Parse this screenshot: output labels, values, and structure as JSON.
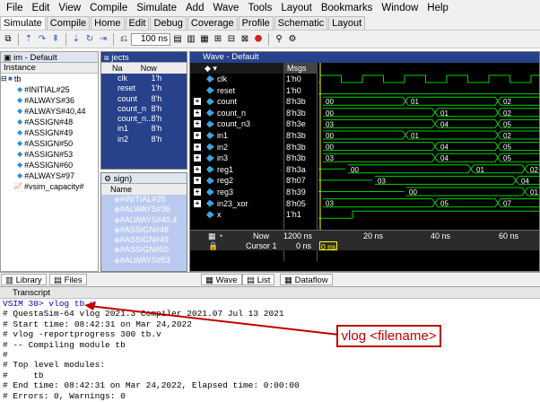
{
  "menubar": {
    "items": [
      "File",
      "Edit",
      "View",
      "Compile",
      "Simulate",
      "Add",
      "Wave",
      "Tools",
      "Layout",
      "Bookmarks",
      "Window",
      "Help"
    ]
  },
  "tabs": [
    "Simulate",
    "Compile",
    "Home",
    "Edit",
    "Debug",
    "Coverage",
    "Profile",
    "Schematic",
    "Layout"
  ],
  "toolbar": {
    "run_length": "100 ns"
  },
  "instance_panel": {
    "title": "im - Default",
    "column_header": "Instance",
    "root": "tb",
    "children": [
      "#INITIAL#25",
      "#ALWAYS#36",
      "#ALWAYS#40,44",
      "#ASSIGN#48",
      "#ASSIGN#49",
      "#ASSIGN#50",
      "#ASSIGN#53",
      "#ASSIGN#60",
      "#ALWAYS#97"
    ],
    "extra": "#vsim_capacity#"
  },
  "objects_panel": {
    "title": "jects",
    "name_header": "Na",
    "now_label": "Now",
    "rows": [
      {
        "name": "clk",
        "value": "1'h"
      },
      {
        "name": "reset",
        "value": "1'h"
      },
      {
        "name": "count",
        "value": "8'h"
      },
      {
        "name": "count_n",
        "value": "8'h"
      },
      {
        "name": "count_n...",
        "value": "8'h"
      },
      {
        "name": "in1",
        "value": "8'h"
      },
      {
        "name": "in2",
        "value": "8'h"
      }
    ]
  },
  "process_panel": {
    "title": "sign)",
    "name_header": "Name",
    "rows": [
      "#INITIAL#25",
      "#ALWAYS#36",
      "#ALWAYS#40,4",
      "#ASSIGN#48",
      "#ASSIGN#49",
      "#ASSIGN#50",
      "#ALWAYS#53"
    ]
  },
  "wave": {
    "title": "Wave - Default",
    "msgs_header": "Msgs",
    "signals": [
      {
        "name": "clk",
        "value": "1'h0",
        "plus": false
      },
      {
        "name": "reset",
        "value": "1'h0",
        "plus": false
      },
      {
        "name": "count",
        "value": "8'h3b",
        "plus": true
      },
      {
        "name": "count_n",
        "value": "8'h3b",
        "plus": true
      },
      {
        "name": "count_n3",
        "value": "8'h3e",
        "plus": true
      },
      {
        "name": "in1",
        "value": "8'h3b",
        "plus": true
      },
      {
        "name": "in2",
        "value": "8'h3b",
        "plus": true
      },
      {
        "name": "in3",
        "value": "8'h3b",
        "plus": true
      },
      {
        "name": "reg1",
        "value": "8'h3a",
        "plus": true
      },
      {
        "name": "reg2",
        "value": "8'h07",
        "plus": true
      },
      {
        "name": "reg3",
        "value": "8'h39",
        "plus": true
      },
      {
        "name": "in23_xor",
        "value": "8'h05",
        "plus": true
      },
      {
        "name": "x",
        "value": "1'h1",
        "plus": false
      }
    ],
    "bus_labels": {
      "count": [
        "00",
        "01",
        "02"
      ],
      "count_n": [
        "00",
        "01",
        "02"
      ],
      "count_n3": [
        "03",
        "04",
        "05"
      ],
      "in1": [
        "00",
        "01",
        "02"
      ],
      "in2": [
        "00",
        "04",
        "05"
      ],
      "in3": [
        "03",
        "04",
        "05"
      ],
      "reg1": [
        "00",
        "01",
        "02"
      ],
      "reg2": [
        "03",
        "04"
      ],
      "reg3": [
        "00",
        "01"
      ],
      "in23_xor": [
        "03",
        "05",
        "07"
      ]
    },
    "now_label": "Now",
    "now_value": "1200 ns",
    "cursor_label": "Cursor 1",
    "cursor_value": "0 ns",
    "cursor_marker": "0 ns",
    "time_ticks": [
      "20 ns",
      "40 ns",
      "60 ns"
    ]
  },
  "bottom_tabs": {
    "left": [
      "Library",
      "Files"
    ],
    "wave": [
      "Wave",
      "List",
      "Dataflow"
    ]
  },
  "transcript": {
    "title": "Transcript",
    "lines": [
      "VSIM 30> vlog tb.v",
      "# QuestaSim-64 vlog 2021.3 Compiler 2021.07 Jul 13 2021",
      "# Start time: 08:42:31 on Mar 24,2022",
      "# vlog -reportprogress 300 tb.v",
      "# -- Compiling module tb",
      "#",
      "# Top level modules:",
      "#     tb",
      "# End time: 08:42:31 on Mar 24,2022, Elapsed time: 0:00:00",
      "# Errors: 0, Warnings: 0"
    ]
  },
  "callout": {
    "text": "vlog <filename>",
    "color": "#c00000"
  },
  "colors": {
    "wave_green": "#00d000",
    "cursor_yellow": "#ffff00",
    "panel_blue": "#27418b"
  }
}
